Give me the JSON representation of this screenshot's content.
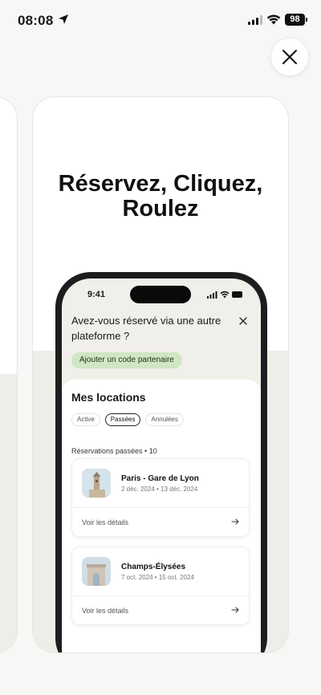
{
  "status_bar": {
    "time": "08:08",
    "battery": "98"
  },
  "headline": {
    "line1": "Réservez,  Cliquez,",
    "line2": "Roulez"
  },
  "phone": {
    "time": "9:41",
    "banner": {
      "title": "Avez-vous réservé via une autre plateforme ?",
      "button": "Ajouter un code partenaire"
    },
    "locations": {
      "title": "Mes locations",
      "tabs": [
        {
          "label": "Active"
        },
        {
          "label": "Passées",
          "selected": true
        },
        {
          "label": "Annulées"
        }
      ],
      "past_count": "Réservations passées • 10",
      "reservations": [
        {
          "name": "Paris - Gare de Lyon",
          "dates": "2 déc. 2024 • 13 déc. 2024",
          "link": "Voir les détails"
        },
        {
          "name": "Champs-Élysées",
          "dates": "7 oct. 2024 • 15 oct. 2024",
          "link": "Voir les détails"
        }
      ]
    }
  },
  "colors": {
    "partner_button": "#cfe7c4",
    "band": "#efede8",
    "phone_frame": "#1d1d1f"
  }
}
